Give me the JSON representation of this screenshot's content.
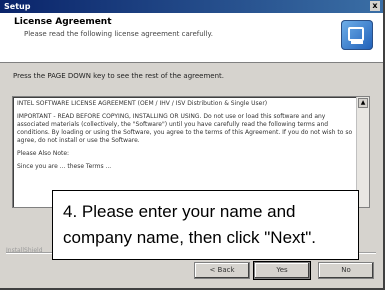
{
  "window": {
    "title": "Setup",
    "close_glyph": "x"
  },
  "header": {
    "title": "License Agreement",
    "subtitle": "Please read the following license agreement carefully."
  },
  "instructions": "Press the PAGE DOWN key to see the rest of the agreement.",
  "license": {
    "paragraphs": [
      "INTEL SOFTWARE LICENSE AGREEMENT (OEM / IHV / ISV Distribution & Single User)",
      "IMPORTANT - READ BEFORE COPYING, INSTALLING OR USING. Do not use or load this software and any associated materials (collectively, the \"Software\") until you have carefully read the following terms and conditions. By loading or using the Software, you agree to the terms of this Agreement. If you do not wish to so agree, do not install or use the Software.",
      "Please Also Note:",
      "Since you are ... these Terms ..."
    ]
  },
  "scrollbar": {
    "up_glyph": "▲"
  },
  "installshield_label": "InstallShield",
  "buttons": {
    "back": "< Back",
    "yes": "Yes",
    "no": "No"
  },
  "callout": {
    "line1": "4. Please enter your name and",
    "line2": "company name, then click \"Next\"."
  }
}
